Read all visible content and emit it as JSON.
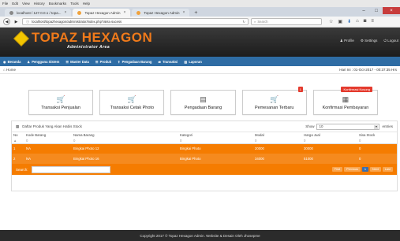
{
  "browser": {
    "menu": [
      "File",
      "Edit",
      "View",
      "History",
      "Bookmarks",
      "Tools",
      "Help"
    ],
    "tabs": [
      {
        "label": "localhost / 127.0.0.1 / topa...",
        "active": false
      },
      {
        "label": "Topaz Hexagon Admin",
        "active": true
      },
      {
        "label": "Topaz Hexagon Admin",
        "active": false
      }
    ],
    "url": "localhost/topazhexagon/administrator/index.php?aksi=sucess",
    "search_placeholder": "Search"
  },
  "site": {
    "title": "TOPAZ HEXAGON",
    "subtitle": "Administrator Area",
    "header_links": [
      "Profile",
      "Settings",
      "Logout"
    ]
  },
  "menu": [
    {
      "icon": "dashboard-icon",
      "glyph": "◉",
      "label": "Beranda"
    },
    {
      "icon": "users-icon",
      "glyph": "♟",
      "label": "Pengguna Sistem"
    },
    {
      "icon": "list-icon",
      "glyph": "☰",
      "label": "Master Data"
    },
    {
      "icon": "list-icon",
      "glyph": "☰",
      "label": "Produk"
    },
    {
      "icon": "upload-icon",
      "glyph": "⇪",
      "label": "Pengadaan Barang"
    },
    {
      "icon": "exchange-icon",
      "glyph": "⇄",
      "label": "Transaksi"
    },
    {
      "icon": "chart-icon",
      "glyph": "▥",
      "label": "Laporan"
    }
  ],
  "crumb": "Home",
  "date": "Hari Ini : 01-Oct-2017 - 00:37:35 Hrs",
  "tiles": [
    {
      "label": "Transaksi Penjualan",
      "icon": "cart-icon",
      "glyph": "🛒",
      "badge": ""
    },
    {
      "label": "Transaksi Cetak Photo",
      "icon": "cart-icon",
      "glyph": "🛒",
      "badge": ""
    },
    {
      "label": "Pengadaan Barang",
      "icon": "clipboard-icon",
      "glyph": "▤",
      "badge": ""
    },
    {
      "label": "Pemesanan Terbaru",
      "icon": "cart-icon",
      "glyph": "🛒",
      "badge": "1"
    },
    {
      "label": "Konfirmasi Pembayaran",
      "icon": "money-icon",
      "glyph": "▦",
      "badge": "Konfirmasi Kosong"
    }
  ],
  "table": {
    "title": "Daftar Produk Yang Akan Habis Stock",
    "show_label": "Show",
    "show_value": "10",
    "entries_label": "entries",
    "columns": [
      "No",
      "Kode Barang",
      "Nama Barang",
      "Kategori",
      "Modal",
      "Harga Jual",
      "Sisa Stock"
    ],
    "filters": [
      "▲",
      "0",
      "0",
      "0",
      "0",
      "0",
      "0"
    ],
    "rows": [
      [
        "1",
        "NA",
        "Bingkai Photo 12",
        "Bingkai Photo",
        "20000",
        "30000",
        "0"
      ],
      [
        "2",
        "NA",
        "Bingkai Photo 16",
        "Bingkai Photo",
        "34000",
        "51000",
        "0"
      ]
    ],
    "search_label": "Search:",
    "pager": [
      "First",
      "Previous",
      "1",
      "Next",
      "Last"
    ]
  },
  "footer": "Copyright 2017 © Topaz Hexagon Admin. Website & Desain Oleh Jhosepme"
}
